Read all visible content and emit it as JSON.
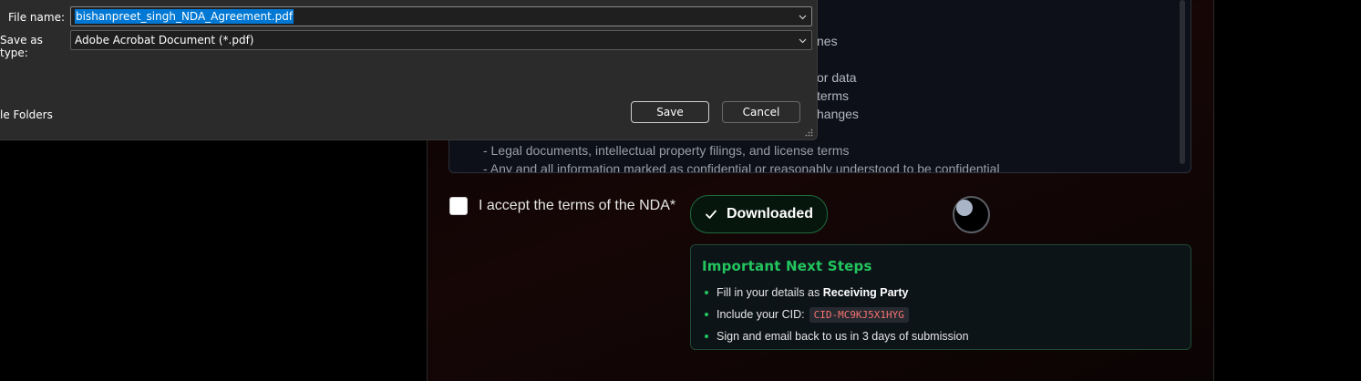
{
  "dialog": {
    "file_name_label": "File name:",
    "file_name_value": "bishanpreet_singh_NDA_Agreement.pdf",
    "save_as_type_label": "Save as type:",
    "save_as_type_value": "Adobe Acrobat Document (*.pdf)",
    "hide_folders_label": "le Folders",
    "save_label": "Save",
    "cancel_label": "Cancel"
  },
  "terms": {
    "partial_lines": [
      "nes",
      "or data",
      "terms",
      "hanges"
    ],
    "lines": [
      "- Legal documents, intellectual property filings, and license terms",
      "- Any and all information marked as confidential or reasonably understood to be confidential"
    ]
  },
  "accept": {
    "label": "I accept the terms of the NDA*"
  },
  "download": {
    "label": "Downloaded"
  },
  "next_steps": {
    "title": "Important Next Steps",
    "step1_prefix": "Fill in your details as ",
    "step1_bold": "Receiving Party",
    "step2_prefix": "Include your CID:",
    "cid": "CID-MC9KJ5X1HYG",
    "step3": "Sign and email back to us in 3 days of submission"
  },
  "colors": {
    "accent_green": "#22c55e",
    "cid_red": "#f87171",
    "selection_blue": "#0078d4"
  }
}
